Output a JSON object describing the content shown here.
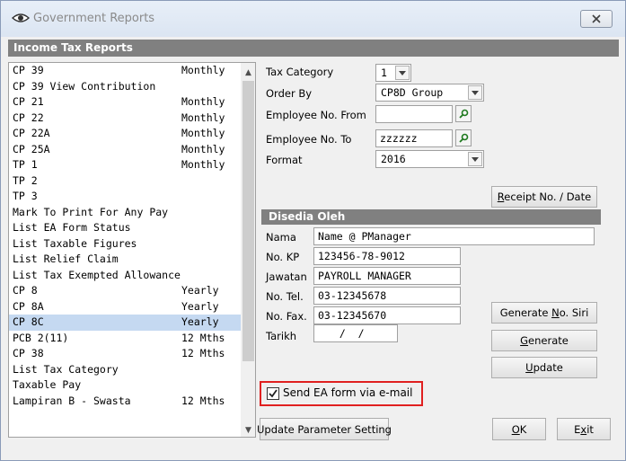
{
  "window": {
    "title": "Government Reports",
    "section_title": "Income Tax Reports"
  },
  "report_list": {
    "selected_index": 16,
    "items": [
      {
        "name": "CP 39",
        "freq": "Monthly"
      },
      {
        "name": "CP 39 View Contribution",
        "freq": ""
      },
      {
        "name": "CP 21",
        "freq": "Monthly"
      },
      {
        "name": "CP 22",
        "freq": "Monthly"
      },
      {
        "name": "CP 22A",
        "freq": "Monthly"
      },
      {
        "name": "CP 25A",
        "freq": "Monthly"
      },
      {
        "name": "TP 1",
        "freq": "Monthly"
      },
      {
        "name": "TP 2",
        "freq": ""
      },
      {
        "name": "TP 3",
        "freq": ""
      },
      {
        "name": "Mark To Print For Any Pay",
        "freq": ""
      },
      {
        "name": "List EA Form Status",
        "freq": ""
      },
      {
        "name": "List Taxable Figures",
        "freq": ""
      },
      {
        "name": "List Relief Claim",
        "freq": ""
      },
      {
        "name": "List Tax Exempted Allowance",
        "freq": ""
      },
      {
        "name": "CP 8",
        "freq": "Yearly"
      },
      {
        "name": "CP 8A",
        "freq": "Yearly"
      },
      {
        "name": "CP 8C",
        "freq": "Yearly"
      },
      {
        "name": "PCB 2(11)",
        "freq": "12 Mths"
      },
      {
        "name": "CP 38",
        "freq": "12 Mths"
      },
      {
        "name": "List Tax Category",
        "freq": ""
      },
      {
        "name": "Taxable Pay",
        "freq": ""
      },
      {
        "name": "Lampiran B - Swasta",
        "freq": "12 Mths"
      }
    ]
  },
  "form": {
    "tax_category_label": "Tax Category",
    "tax_category_value": "1",
    "order_by_label": "Order By",
    "order_by_value": "CP8D Group",
    "emp_from_label": "Employee No. From",
    "emp_from_value": "",
    "emp_to_label": "Employee No. To",
    "emp_to_value": "zzzzzz",
    "format_label": "Format",
    "format_value": "2016"
  },
  "disedia": {
    "header": "Disedia Oleh",
    "nama_label": "Nama",
    "nama_value": "Name @ PManager",
    "nokp_label": "No. KP",
    "nokp_value": "123456-78-9012",
    "jawatan_label": "Jawatan",
    "jawatan_value": "PAYROLL MANAGER",
    "notel_label": "No. Tel.",
    "notel_value": "03-12345678",
    "nofax_label": "No. Fax.",
    "nofax_value": "03-12345670",
    "tarikh_label": "Tarikh",
    "tarikh_value": "  /  /"
  },
  "buttons": {
    "receipt_pre": "R",
    "receipt_post": "eceipt No. / Date",
    "gen_siri_pre": "Generate ",
    "gen_siri_u": "N",
    "gen_siri_post": "o. Siri",
    "generate_u": "G",
    "generate_post": "enerate",
    "update_u": "U",
    "update_post": "pdate",
    "update_param": "Update Parameter Setting",
    "ok_u": "O",
    "ok_post": "K",
    "exit_pre": "E",
    "exit_u": "x",
    "exit_post": "it"
  },
  "email": {
    "label": "Send EA form via e-mail",
    "checked": true
  },
  "colors": {
    "highlight_border": "#e02020",
    "selected_row": "#c5d9f1",
    "header_gray": "#808080"
  }
}
